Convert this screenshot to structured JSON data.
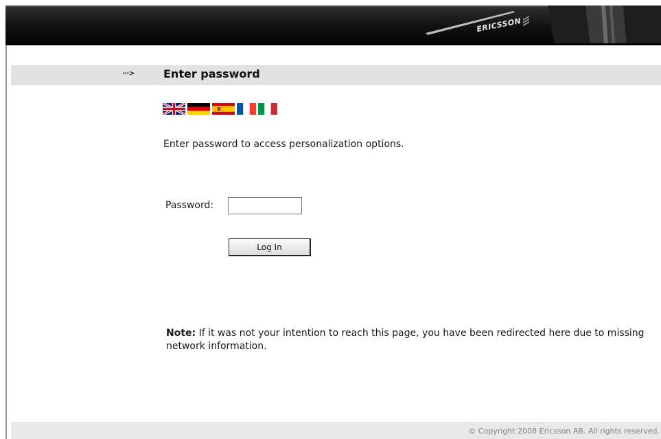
{
  "header": {
    "brand": "ERICSSON"
  },
  "title": {
    "text": "Enter password",
    "arrow": "···>"
  },
  "languages": [
    {
      "name": "English",
      "icon": "uk-flag-icon"
    },
    {
      "name": "German",
      "icon": "german-flag-icon"
    },
    {
      "name": "Spanish",
      "icon": "spanish-flag-icon"
    },
    {
      "name": "French",
      "icon": "french-flag-icon"
    },
    {
      "name": "Italian",
      "icon": "italian-flag-icon"
    }
  ],
  "form": {
    "intro": "Enter password to access personalization options.",
    "password_label": "Password:",
    "password_value": "",
    "login_label": "Log In"
  },
  "note": {
    "label": "Note:",
    "text": "If it was not your intention to reach this page, you have been redirected here due to missing network information."
  },
  "footer": {
    "copyright": "© Copyright 2008 Ericsson AB. All rights reserved."
  },
  "colors": {
    "header": "#0e0e0e",
    "title_band": "#e2e2e2",
    "footer": "#e8e8e8"
  }
}
